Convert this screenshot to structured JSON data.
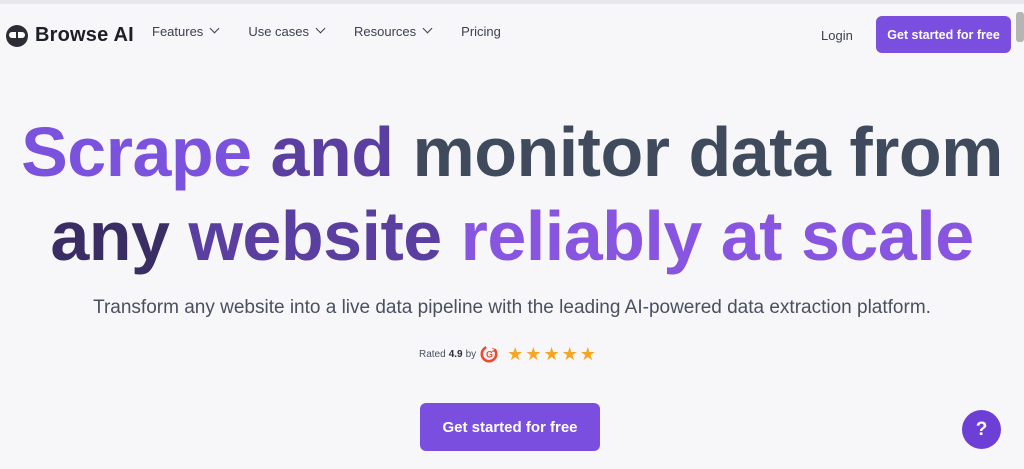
{
  "header": {
    "logo_text": "Browse AI",
    "nav": [
      {
        "label": "Features",
        "has_dropdown": true
      },
      {
        "label": "Use cases",
        "has_dropdown": true
      },
      {
        "label": "Resources",
        "has_dropdown": true
      },
      {
        "label": "Pricing",
        "has_dropdown": false
      }
    ],
    "login_label": "Login",
    "cta_label": "Get started for free"
  },
  "hero": {
    "headline_line1": [
      "Scrape",
      "and",
      "monitor",
      "data",
      "from"
    ],
    "headline_line2": [
      "any",
      "website",
      "reliably",
      "at",
      "scale"
    ],
    "subtitle": "Transform any website into a live data pipeline with the leading AI-powered data extraction platform.",
    "rating": {
      "prefix": "Rated",
      "score": "4.9",
      "suffix": "by",
      "badge": "g2-logo-icon",
      "stars": 5
    },
    "cta_label": "Get started for free"
  },
  "help_button": {
    "label": "?"
  },
  "colors": {
    "accent": "#7a4fe0",
    "headline_purple": "#7b52de",
    "headline_slate": "#3f4a5c",
    "star": "#f6a623",
    "g2_red": "#ef4a2f"
  }
}
